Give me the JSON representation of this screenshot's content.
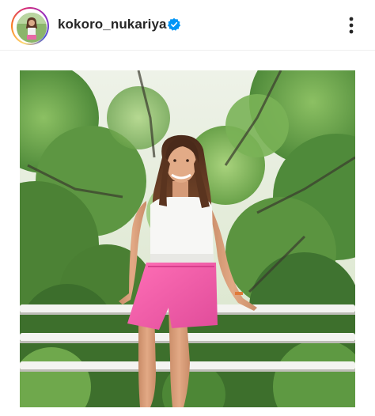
{
  "post": {
    "username": "kokoro_nukariya",
    "verified": true,
    "avatar_icon": "profile-avatar",
    "more_icon": "more-options-icon",
    "verified_icon": "verified-badge-icon"
  },
  "colors": {
    "username": "#262626",
    "verified_blue": "#0095f6",
    "ring_start": "#feda75",
    "ring_end": "#962fbf"
  }
}
